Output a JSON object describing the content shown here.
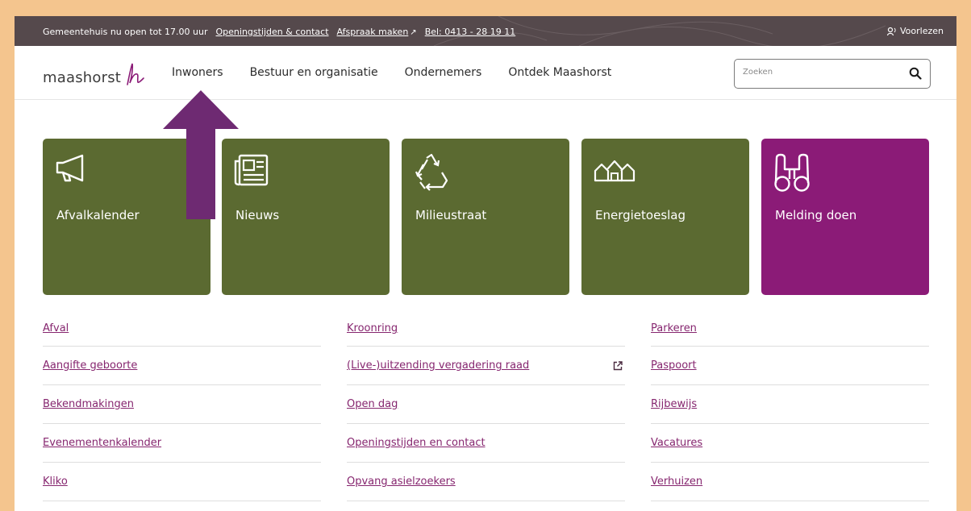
{
  "topbar": {
    "notice": "Gemeentehuis nu open tot 17.00 uur",
    "link_hours": "Openingstijden & contact",
    "link_appointment": "Afspraak maken",
    "link_phone": "Bel: 0413 - 28 19 11",
    "read_aloud": "Voorlezen"
  },
  "header": {
    "logo_text": "maashorst",
    "nav": [
      "Inwoners",
      "Bestuur en organisatie",
      "Ondernemers",
      "Ontdek Maashorst"
    ],
    "search_placeholder": "Zoeken"
  },
  "tiles": [
    {
      "label": "Afvalkalender",
      "icon": "megaphone-icon"
    },
    {
      "label": "Nieuws",
      "icon": "newspaper-icon"
    },
    {
      "label": "Milieustraat",
      "icon": "recycle-icon"
    },
    {
      "label": "Energietoeslag",
      "icon": "houses-icon"
    },
    {
      "label": "Melding doen",
      "icon": "binoculars-icon"
    }
  ],
  "links": {
    "col1": [
      "Afval",
      "Aangifte geboorte",
      "Bekendmakingen",
      "Evenementenkalender",
      "Kliko"
    ],
    "col2": [
      "Kroonring",
      "(Live-)uitzending vergadering raad",
      "Open dag",
      "Openingstijden en contact",
      "Opvang asielzoekers"
    ],
    "col3": [
      "Parkeren",
      "Paspoort",
      "Rijbewijs",
      "Vacatures",
      "Verhuizen"
    ]
  },
  "colors": {
    "green_tile": "#5b6a31",
    "purple_tile": "#8b1b77",
    "link": "#86266f",
    "topbar": "#55494c",
    "page_border": "#f4c58e",
    "annotation_arrow": "#6e2a72"
  }
}
